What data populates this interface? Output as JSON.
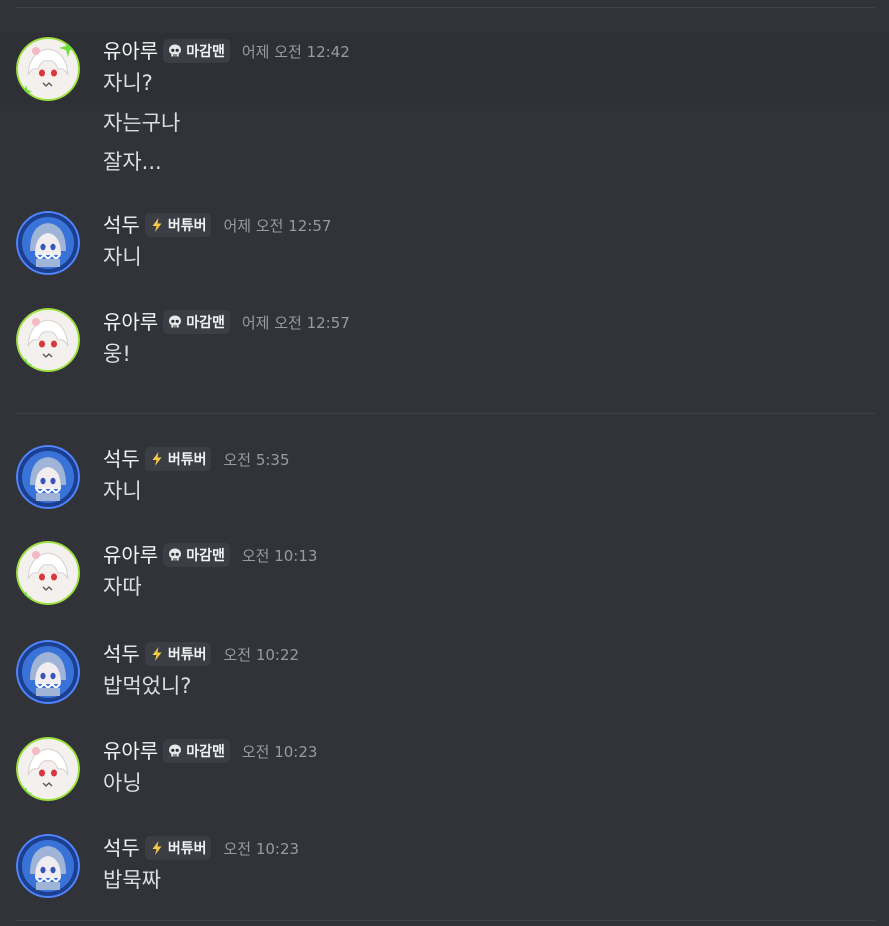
{
  "users": {
    "yuaru": {
      "name": "유아루",
      "tag": "마감맨",
      "tag_icon": "skull-icon",
      "avatar_icon": "white-hair-girl-avatar-icon"
    },
    "seokdu": {
      "name": "석두",
      "tag": "버튜버",
      "tag_icon": "lightning-bolt-icon",
      "avatar_icon": "shark-hood-girl-avatar-icon"
    }
  },
  "colors": {
    "background": "#313338",
    "hover_background": "#2e3035",
    "username": "#f2f3f5",
    "message_text": "#dbdee1",
    "timestamp": "#949ba4",
    "tag_background": "#3c3e45",
    "lightning": "#f7c948",
    "avatar_green_ring": "#9be03c",
    "avatar_blue_ring": "#4f86ff"
  },
  "messages": [
    {
      "author": "유아루",
      "tag": "마감맨",
      "time": "어제 오전 12:42",
      "lines": [
        "자니?",
        "자는구나",
        "잘자..."
      ]
    },
    {
      "author": "석두",
      "tag": "버튜버",
      "time": "어제 오전 12:57",
      "lines": [
        "자니"
      ]
    },
    {
      "author": "유아루",
      "tag": "마감맨",
      "time": "어제 오전 12:57",
      "lines": [
        "웅!"
      ]
    },
    {
      "author": "석두",
      "tag": "버튜버",
      "time": "오전 5:35",
      "lines": [
        "자니"
      ]
    },
    {
      "author": "유아루",
      "tag": "마감맨",
      "time": "오전 10:13",
      "lines": [
        "자따"
      ]
    },
    {
      "author": "석두",
      "tag": "버튜버",
      "time": "오전 10:22",
      "lines": [
        "밥먹었니?"
      ]
    },
    {
      "author": "유아루",
      "tag": "마감맨",
      "time": "오전 10:23",
      "lines": [
        "아닝"
      ]
    },
    {
      "author": "석두",
      "tag": "버튜버",
      "time": "오전 10:23",
      "lines": [
        "밥묵짜"
      ]
    }
  ]
}
